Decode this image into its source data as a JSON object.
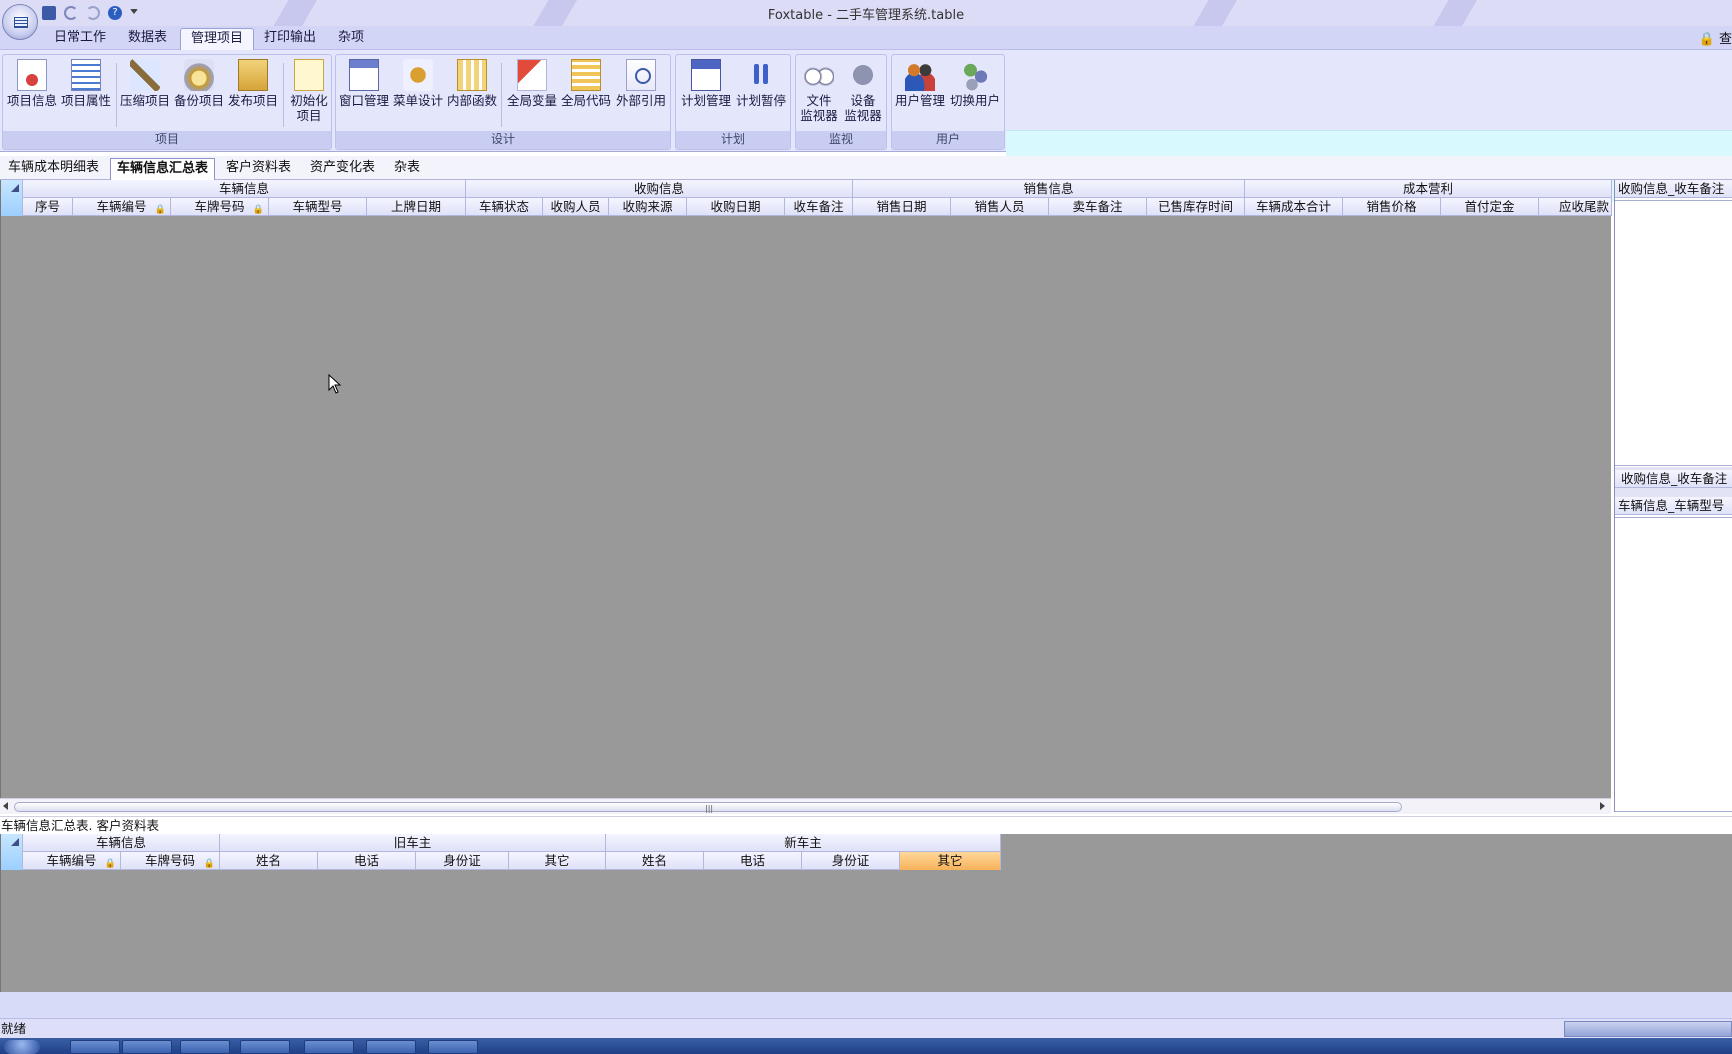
{
  "window": {
    "title": "Foxtable - 二手车管理系统.table"
  },
  "menu": {
    "tabs": [
      {
        "label": "日常工作"
      },
      {
        "label": "数据表"
      },
      {
        "label": "管理项目"
      },
      {
        "label": "打印输出"
      },
      {
        "label": "杂项"
      }
    ],
    "active": "管理项目",
    "corner_text": "🔒 查"
  },
  "ribbon": {
    "groups": [
      {
        "label": "项目",
        "buttons": [
          "项目信息",
          "项目属性",
          "压缩项目",
          "备份项目",
          "发布项目",
          "初始化\n项目"
        ]
      },
      {
        "label": "设计",
        "buttons": [
          "窗口管理",
          "菜单设计",
          "内部函数",
          "全局变量",
          "全局代码",
          "外部引用"
        ]
      },
      {
        "label": "计划",
        "buttons": [
          "计划管理",
          "计划暂停"
        ]
      },
      {
        "label": "监视",
        "buttons": [
          "文件\n监视器",
          "设备\n监视器"
        ]
      },
      {
        "label": "用户",
        "buttons": [
          "用户管理",
          "切换用户"
        ]
      }
    ]
  },
  "sheet_tabs": {
    "items": [
      {
        "label": "车辆成本明细表"
      },
      {
        "label": "车辆信息汇总表"
      },
      {
        "label": "客户资料表"
      },
      {
        "label": "资产变化表"
      },
      {
        "label": "杂表"
      }
    ],
    "active": "车辆信息汇总表"
  },
  "main_grid": {
    "groups": [
      "车辆信息",
      "收购信息",
      "销售信息",
      "成本营利"
    ],
    "columns": [
      "序号",
      "车辆编号",
      "车牌号码",
      "车辆型号",
      "上牌日期",
      "车辆状态",
      "收购人员",
      "收购来源",
      "收购日期",
      "收车备注",
      "销售日期",
      "销售人员",
      "卖车备注",
      "已售库存时间",
      "车辆成本合计",
      "销售价格",
      "首付定金",
      "应收尾款"
    ],
    "locked_columns": [
      "车辆编号",
      "车牌号码"
    ]
  },
  "side_panel": {
    "header1": "收购信息_收车备注",
    "header2": "收购信息_收车备注",
    "header3": "车辆信息_车辆型号"
  },
  "relation_label": "车辆信息汇总表. 客户资料表",
  "sub_grid": {
    "groups": [
      "车辆信息",
      "旧车主",
      "新车主"
    ],
    "columns": [
      "车辆编号",
      "车牌号码",
      "姓名",
      "电话",
      "身份证",
      "其它",
      "姓名",
      "电话",
      "身份证",
      "其它"
    ],
    "highlighted_column": "其它"
  },
  "status": {
    "text": "就绪"
  }
}
